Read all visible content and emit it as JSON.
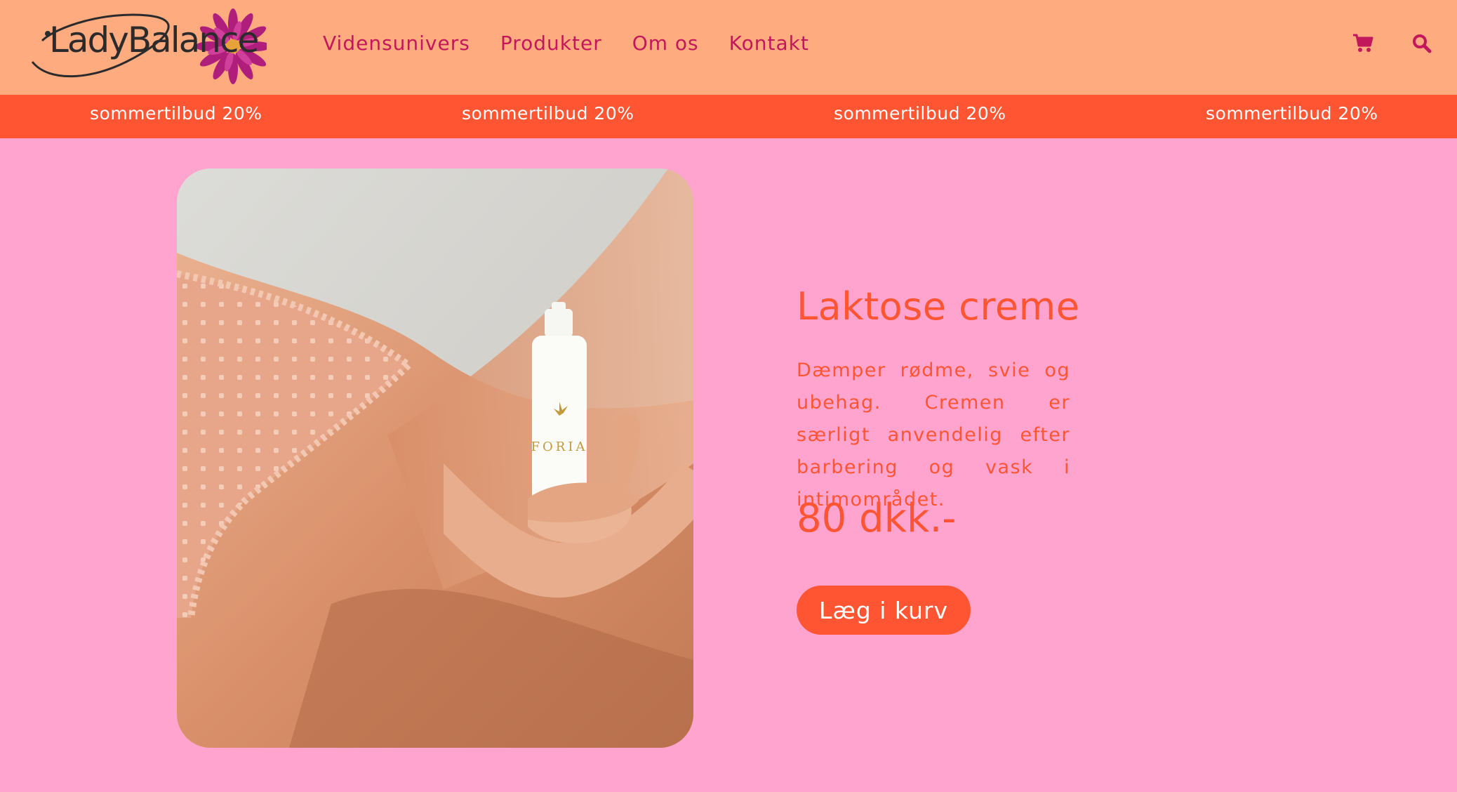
{
  "brand": {
    "logo_text": "LadyBalance"
  },
  "nav": {
    "items": [
      {
        "label": "Vidensunivers"
      },
      {
        "label": "Produkter"
      },
      {
        "label": "Om os"
      },
      {
        "label": "Kontakt"
      }
    ],
    "cart_icon": "shopping-cart-icon",
    "search_icon": "search-icon"
  },
  "banner": {
    "items": [
      "sommertilbud 20%",
      "sommertilbud 20%",
      "sommertilbud 20%",
      "sommertilbud 20%"
    ]
  },
  "product": {
    "image_alt": "",
    "bottle_brand": "FORIA",
    "title": "Laktose creme",
    "description": "Dæmper rødme, svie og ubehag. Cremen er særligt anvendelig efter barbering og vask i intimområdet.",
    "price": "80 dkk.-",
    "add_to_cart_label": "Læg i kurv"
  },
  "colors": {
    "header_bg": "#ffab80",
    "banner_bg": "#ff5533",
    "page_bg": "#ffa4cf",
    "nav_text": "#c2185b",
    "accent": "#ff5533"
  }
}
